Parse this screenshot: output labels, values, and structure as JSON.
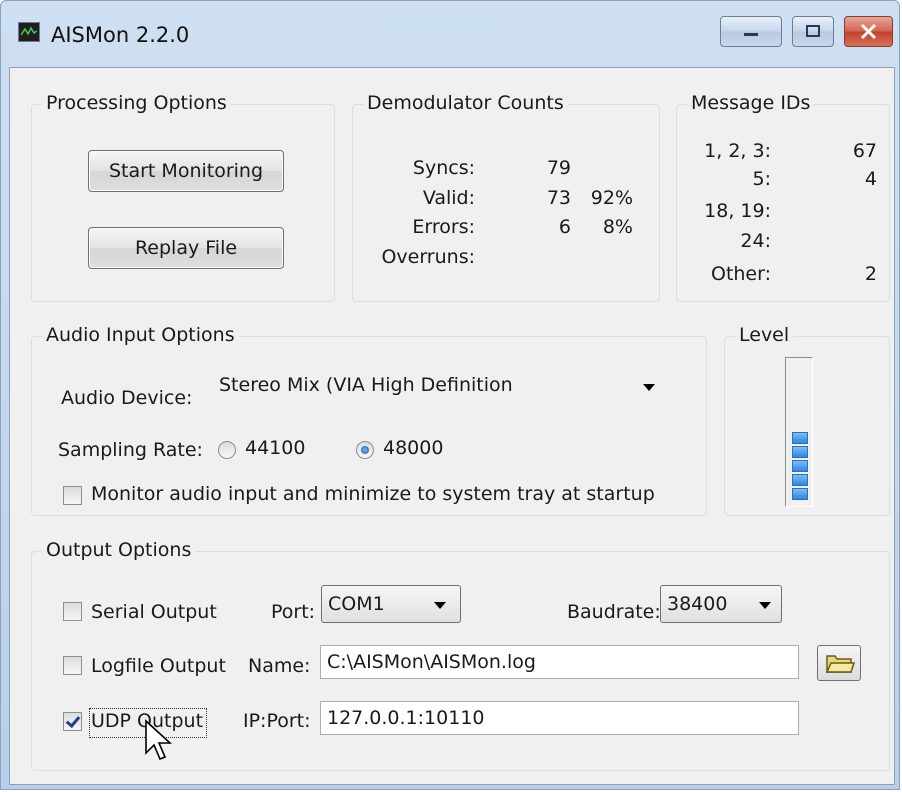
{
  "window": {
    "title": "AISMon 2.2.0",
    "minimize_icon": "minimize-icon",
    "maximize_icon": "maximize-icon",
    "close_icon": "close-icon"
  },
  "processing": {
    "legend": "Processing Options",
    "start_label": "Start Monitoring",
    "replay_label": "Replay File"
  },
  "demodulator": {
    "legend": "Demodulator Counts",
    "rows": [
      {
        "label": "Syncs:",
        "count": "79",
        "pct": ""
      },
      {
        "label": "Valid:",
        "count": "73",
        "pct": "92%"
      },
      {
        "label": "Errors:",
        "count": "6",
        "pct": "8%"
      },
      {
        "label": "Overruns:",
        "count": "",
        "pct": ""
      }
    ]
  },
  "message_ids": {
    "legend": "Message IDs",
    "rows": [
      {
        "label": "1, 2, 3:",
        "value": "67"
      },
      {
        "label": "5:",
        "value": "4"
      },
      {
        "label": "18, 19:",
        "value": ""
      },
      {
        "label": "24:",
        "value": ""
      },
      {
        "label": "Other:",
        "value": "2"
      }
    ]
  },
  "audio": {
    "legend": "Audio Input Options",
    "device_label": "Audio Device:",
    "device_value": "Stereo Mix (VIA High Definition",
    "sampling_label": "Sampling Rate:",
    "rate_44100": "44100",
    "rate_48000": "48000",
    "selected_rate": "48000",
    "monitor_label": "Monitor audio input and minimize to system tray at startup",
    "monitor_checked": false
  },
  "level": {
    "legend": "Level",
    "lit_segments": 5,
    "total_segments": 12,
    "segment_color": "#2f86e0"
  },
  "output": {
    "legend": "Output Options",
    "serial_label": "Serial Output",
    "serial_checked": false,
    "port_label": "Port:",
    "port_value": "COM1",
    "baud_label": "Baudrate:",
    "baud_value": "38400",
    "logfile_label": "Logfile Output",
    "logfile_checked": false,
    "name_label": "Name:",
    "name_value": "C:\\AISMon\\AISMon.log",
    "browse_icon": "folder-icon",
    "udp_label": "UDP Output",
    "udp_checked": true,
    "ipport_label": "IP:Port:",
    "ipport_value": "127.0.0.1:10110"
  }
}
